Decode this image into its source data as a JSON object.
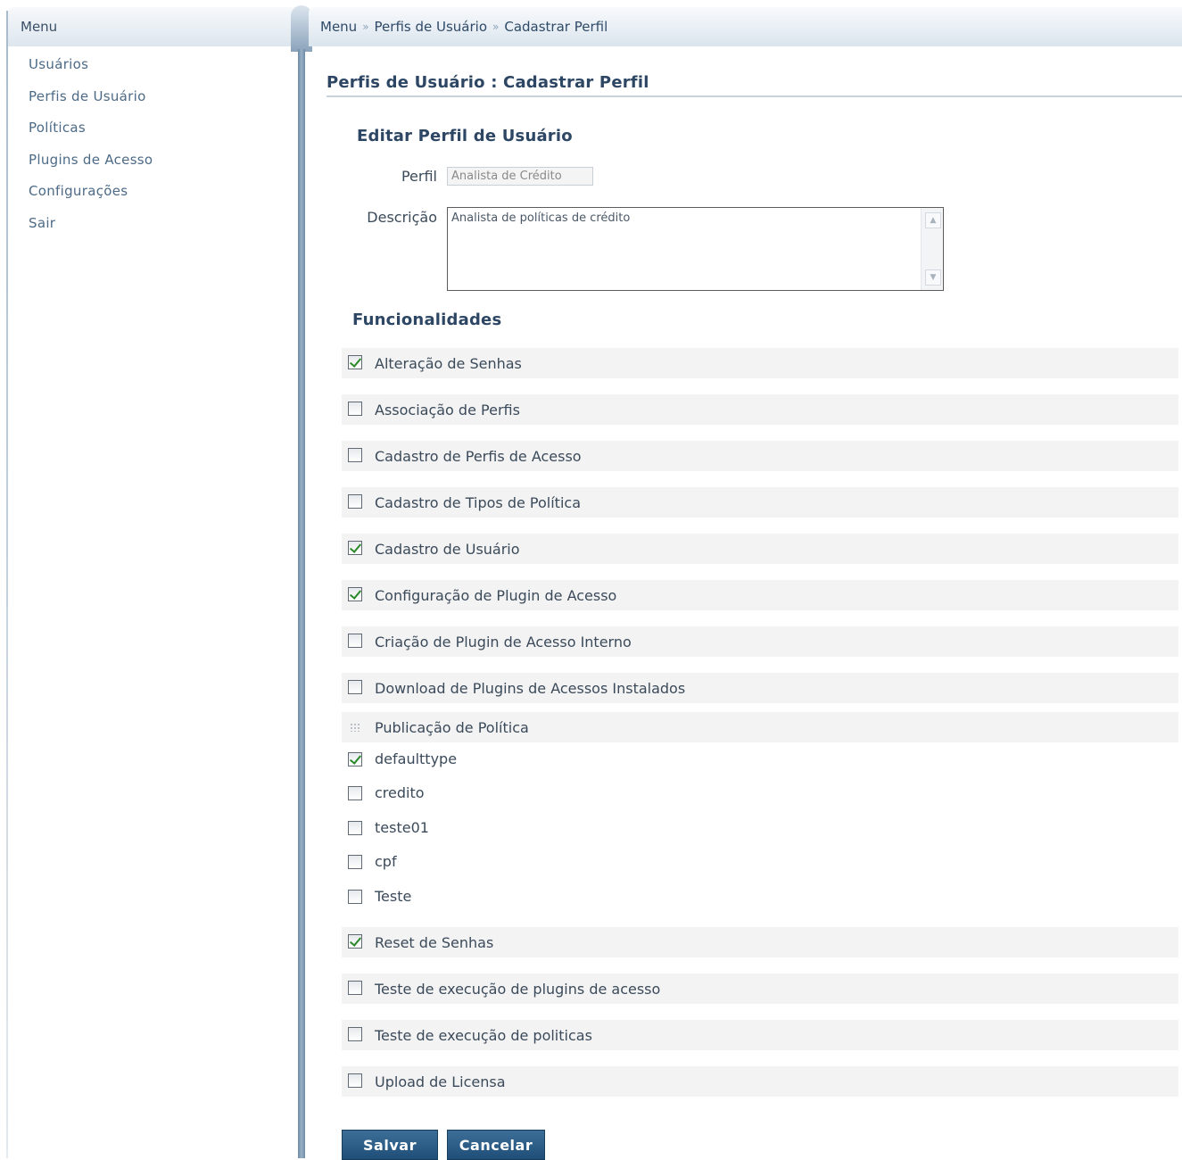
{
  "sidebar": {
    "header": "Menu",
    "items": [
      "Usuários",
      "Perfis de Usuário",
      "Políticas",
      "Plugins de Acesso",
      "Configurações",
      "Sair"
    ]
  },
  "breadcrumb": {
    "items": [
      "Menu",
      "Perfis de Usuário",
      "Cadastrar Perfil"
    ]
  },
  "page": {
    "title": "Perfis de Usuário : Cadastrar Perfil",
    "section_title": "Editar Perfil de Usuário",
    "perfil_label": "Perfil",
    "perfil_value": "Analista de Crédito",
    "descricao_label": "Descrição",
    "descricao_value": "Analista de políticas de crédito",
    "funcionalidades_title": "Funcionalidades"
  },
  "funcionalidades": [
    {
      "label": "Alteração de Senhas",
      "checked": true
    },
    {
      "label": "Associação de Perfis",
      "checked": false
    },
    {
      "label": "Cadastro de Perfis de Acesso",
      "checked": false
    },
    {
      "label": "Cadastro de Tipos de Política",
      "checked": false
    },
    {
      "label": "Cadastro de Usuário",
      "checked": true
    },
    {
      "label": "Configuração de Plugin de Acesso",
      "checked": true
    },
    {
      "label": "Criação de Plugin de Acesso Interno",
      "checked": false
    },
    {
      "label": "Download de Plugins de Acessos Instalados",
      "checked": false
    }
  ],
  "publicacao": {
    "label": "Publicação de Política",
    "types": [
      {
        "label": "defaulttype",
        "checked": true
      },
      {
        "label": "credito",
        "checked": false
      },
      {
        "label": "teste01",
        "checked": false
      },
      {
        "label": "cpf",
        "checked": false
      },
      {
        "label": "Teste",
        "checked": false
      }
    ]
  },
  "funcionalidades_rest": [
    {
      "label": "Reset de Senhas",
      "checked": true
    },
    {
      "label": "Teste de execução de plugins de acesso",
      "checked": false
    },
    {
      "label": "Teste de execução de politicas",
      "checked": false
    },
    {
      "label": "Upload de Licensa",
      "checked": false
    }
  ],
  "buttons": {
    "save": "Salvar",
    "cancel": "Cancelar"
  },
  "colors": {
    "heading": "#2d4663",
    "link": "#4d6a86",
    "button": "#1f4f78",
    "row_bg": "#f3f3f3",
    "check": "#2a8a2a"
  },
  "icons": {
    "breadcrumb_separator": "double-chevron-right-icon",
    "scroll_up": "arrow-up-icon",
    "scroll_down": "arrow-down-icon",
    "group_handle": "grip-icon"
  }
}
